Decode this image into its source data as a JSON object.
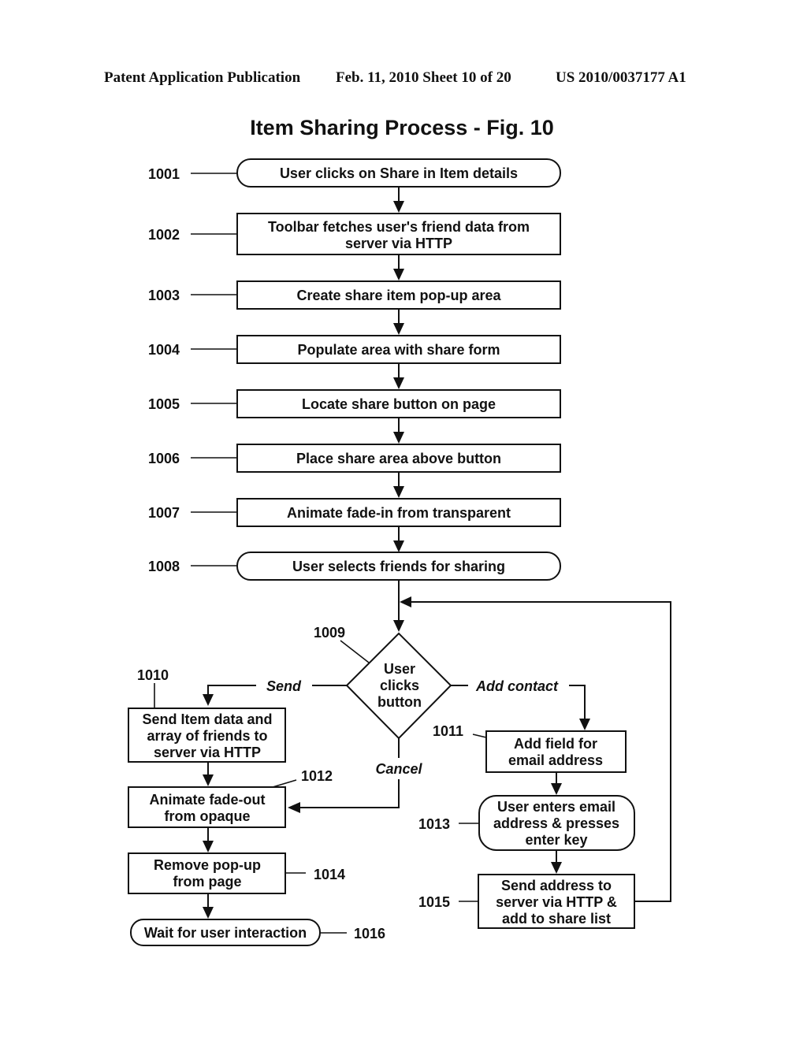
{
  "header": {
    "left": "Patent Application Publication",
    "middle": "Feb. 11, 2010   Sheet 10 of 20",
    "right": "US 2010/0037177 A1"
  },
  "figure": {
    "title": "Item Sharing Process - Fig. 10"
  },
  "nodes": {
    "n1001": {
      "ref": "1001",
      "shape": "terminal",
      "lines": [
        "User clicks on Share in Item details"
      ]
    },
    "n1002": {
      "ref": "1002",
      "shape": "process",
      "lines": [
        "Toolbar fetches user's friend data from",
        "server via HTTP"
      ]
    },
    "n1003": {
      "ref": "1003",
      "shape": "process",
      "lines": [
        "Create share item pop-up area"
      ]
    },
    "n1004": {
      "ref": "1004",
      "shape": "process",
      "lines": [
        "Populate area with share form"
      ]
    },
    "n1005": {
      "ref": "1005",
      "shape": "process",
      "lines": [
        "Locate share button on page"
      ]
    },
    "n1006": {
      "ref": "1006",
      "shape": "process",
      "lines": [
        "Place share area above button"
      ]
    },
    "n1007": {
      "ref": "1007",
      "shape": "process",
      "lines": [
        "Animate fade-in from transparent"
      ]
    },
    "n1008": {
      "ref": "1008",
      "shape": "terminal",
      "lines": [
        "User selects friends for sharing"
      ]
    },
    "n1009": {
      "ref": "1009",
      "shape": "decision",
      "lines": [
        "User",
        "clicks",
        "button"
      ]
    },
    "n1010": {
      "ref": "1010",
      "shape": "process",
      "lines": [
        "Send Item data and",
        "array of friends to",
        "server via HTTP"
      ]
    },
    "n1011": {
      "ref": "1011",
      "shape": "process",
      "lines": [
        "Add field for",
        "email address"
      ]
    },
    "n1012": {
      "ref": "1012",
      "shape": "process",
      "lines": [
        "Animate fade-out",
        "from opaque"
      ]
    },
    "n1013": {
      "ref": "1013",
      "shape": "terminal",
      "lines": [
        "User enters email",
        "address & presses",
        "enter key"
      ]
    },
    "n1014": {
      "ref": "1014",
      "shape": "process",
      "lines": [
        "Remove pop-up",
        "from page"
      ]
    },
    "n1015": {
      "ref": "1015",
      "shape": "process",
      "lines": [
        "Send address to",
        "server via HTTP &",
        "add to share list"
      ]
    },
    "n1016": {
      "ref": "1016",
      "shape": "terminal",
      "lines": [
        "Wait for user interaction"
      ]
    }
  },
  "edge_labels": {
    "send": "Send",
    "add_contact": "Add contact",
    "cancel": "Cancel"
  },
  "edges": [
    {
      "from": "1001",
      "to": "1002"
    },
    {
      "from": "1002",
      "to": "1003"
    },
    {
      "from": "1003",
      "to": "1004"
    },
    {
      "from": "1004",
      "to": "1005"
    },
    {
      "from": "1005",
      "to": "1006"
    },
    {
      "from": "1006",
      "to": "1007"
    },
    {
      "from": "1007",
      "to": "1008"
    },
    {
      "from": "1008",
      "to": "1009"
    },
    {
      "from": "1009",
      "to": "1010",
      "label": "Send"
    },
    {
      "from": "1009",
      "to": "1011",
      "label": "Add contact"
    },
    {
      "from": "1009",
      "to": "1012",
      "label": "Cancel"
    },
    {
      "from": "1010",
      "to": "1012"
    },
    {
      "from": "1012",
      "to": "1014"
    },
    {
      "from": "1014",
      "to": "1016"
    },
    {
      "from": "1011",
      "to": "1013"
    },
    {
      "from": "1013",
      "to": "1015"
    },
    {
      "from": "1015",
      "to": "1009"
    }
  ]
}
